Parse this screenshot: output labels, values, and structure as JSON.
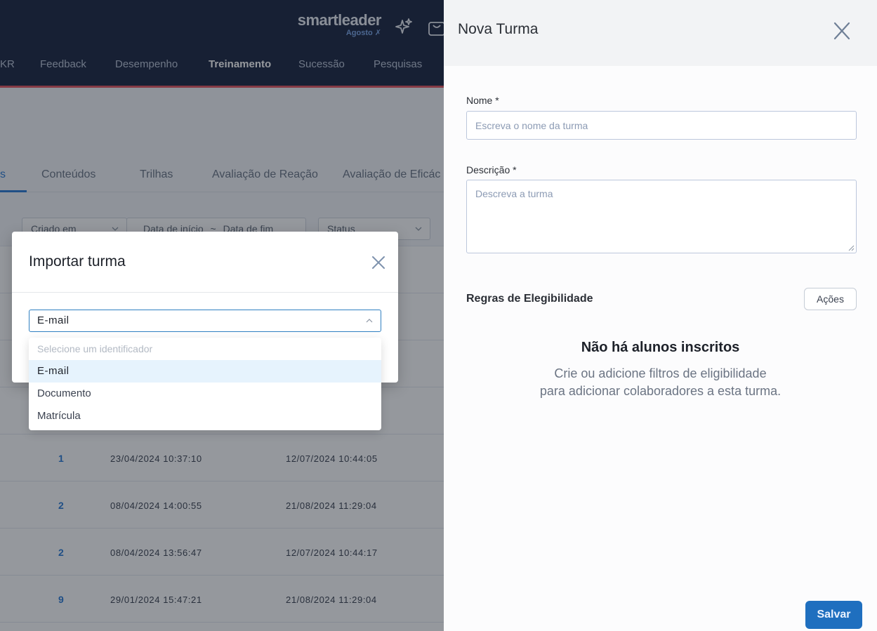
{
  "header": {
    "brand_name": "smartleader",
    "brand_sub": "Agosto",
    "nav": [
      "KR",
      "Feedback",
      "Desempenho",
      "Treinamento",
      "Sucessão",
      "Pesquisas"
    ],
    "active_nav": "Treinamento"
  },
  "tabs": [
    "s",
    "Conteúdos",
    "Trilhas",
    "Avaliação de Reação",
    "Avaliação de Eficác"
  ],
  "filters": {
    "sort": "Criado em",
    "date_start": "Data de início",
    "date_sep": "~",
    "date_end": "Data de fim",
    "status": "Status"
  },
  "table": {
    "rows": [
      {
        "count": "1",
        "created": "23/04/2024 10:37:10",
        "updated": "12/07/2024 10:44:05"
      },
      {
        "count": "2",
        "created": "08/04/2024 14:00:55",
        "updated": "21/08/2024 11:29:04"
      },
      {
        "count": "2",
        "created": "08/04/2024 13:56:47",
        "updated": "12/07/2024 10:44:17"
      },
      {
        "count": "9",
        "created": "29/01/2024 15:47:21",
        "updated": "21/08/2024 11:29:04"
      }
    ]
  },
  "drawer": {
    "title": "Nova Turma",
    "name_label": "Nome *",
    "name_placeholder": "Escreva o nome da turma",
    "desc_label": "Descrição *",
    "desc_placeholder": "Descreva a turma",
    "rules_title": "Regras de Elegibilidade",
    "actions_label": "Ações",
    "empty_title": "Não há alunos inscritos",
    "empty_line1": "Crie ou adicione filtros de eligibilidade",
    "empty_line2": "para adicionar colaboradores a esta turma.",
    "save_label": "Salvar"
  },
  "modal": {
    "title": "Importar turma",
    "selected_value": "E-mail",
    "options": {
      "placeholder": "Selecione um identificador",
      "email": "E-mail",
      "document": "Documento",
      "registration": "Matrícula"
    }
  },
  "colors": {
    "header_bg": "#1b2540",
    "accent_red": "#e2545f",
    "primary_blue": "#1f6fbf",
    "link_blue": "#2b7bd6"
  }
}
